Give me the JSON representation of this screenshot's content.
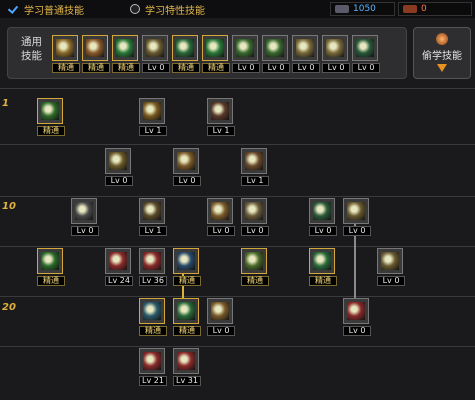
{
  "tabs": {
    "general_label": "学习普通技能",
    "special_label": "学习特性技能"
  },
  "currency": {
    "sp_value": "1050",
    "tp_value": "0"
  },
  "general_panel": {
    "label": "通用技能",
    "skills": [
      {
        "tag": "精通",
        "color": "#8a6a2a"
      },
      {
        "tag": "精通",
        "color": "#8a5a2a"
      },
      {
        "tag": "精通",
        "color": "#2a7a3a"
      },
      {
        "tag": "Lv 0",
        "color": "#6a5a30"
      },
      {
        "tag": "精通",
        "color": "#2a6a3a"
      },
      {
        "tag": "精通",
        "color": "#2a7a3a"
      },
      {
        "tag": "Lv 0",
        "color": "#3a6a30"
      },
      {
        "tag": "Lv 0",
        "color": "#3a6a30"
      },
      {
        "tag": "Lv 0",
        "color": "#7a6a3a"
      },
      {
        "tag": "Lv 0",
        "color": "#7a6a3a"
      },
      {
        "tag": "Lv 0",
        "color": "#2a5a3a"
      }
    ]
  },
  "peek_button": {
    "label": "偷学技能"
  },
  "tree": {
    "level_labels": [
      "1",
      "10",
      "20"
    ],
    "skills": [
      {
        "id": "r1a",
        "tag": "精通",
        "color": "#2f6a2a"
      },
      {
        "id": "r1b",
        "tag": "Lv 1",
        "color": "#7a5a20"
      },
      {
        "id": "r1c",
        "tag": "Lv 1",
        "color": "#5a3a2a"
      },
      {
        "id": "r2a",
        "tag": "Lv 0",
        "color": "#6a5a2a"
      },
      {
        "id": "r2b",
        "tag": "Lv 0",
        "color": "#7a5a2a"
      },
      {
        "id": "r2c",
        "tag": "Lv 1",
        "color": "#6a4a2a"
      },
      {
        "id": "r3a",
        "tag": "Lv 0",
        "color": "#4a4a4a"
      },
      {
        "id": "r3b",
        "tag": "Lv 1",
        "color": "#5a4a2a"
      },
      {
        "id": "r3c",
        "tag": "Lv 0",
        "color": "#7a5a2a"
      },
      {
        "id": "r3d",
        "tag": "Lv 0",
        "color": "#6a5a3a"
      },
      {
        "id": "r3e",
        "tag": "Lv 0",
        "color": "#2a5a3a"
      },
      {
        "id": "r3f",
        "tag": "Lv 0",
        "color": "#6a5a30"
      },
      {
        "id": "r4a",
        "tag": "精通",
        "color": "#2a6a2a"
      },
      {
        "id": "r4b",
        "tag": "Lv 24",
        "color": "#8a2a2a"
      },
      {
        "id": "r4c",
        "tag": "Lv 36",
        "color": "#8a2a2a"
      },
      {
        "id": "r4d",
        "tag": "精通",
        "color": "#2a4a6a"
      },
      {
        "id": "r4e",
        "tag": "精通",
        "color": "#4a6a2a"
      },
      {
        "id": "r4f",
        "tag": "精通",
        "color": "#2a6a3a"
      },
      {
        "id": "r4g",
        "tag": "Lv 0",
        "color": "#6a5a30"
      },
      {
        "id": "r5a",
        "tag": "精通",
        "color": "#2a5a6a"
      },
      {
        "id": "r5b",
        "tag": "精通",
        "color": "#2a6a3a"
      },
      {
        "id": "r5c",
        "tag": "Lv 0",
        "color": "#7a5a2a"
      },
      {
        "id": "r5d",
        "tag": "Lv 0",
        "color": "#8a2a2a"
      },
      {
        "id": "r6a",
        "tag": "Lv 21",
        "color": "#8a2a2a"
      },
      {
        "id": "r6b",
        "tag": "Lv 31",
        "color": "#8a2a2a"
      }
    ]
  }
}
